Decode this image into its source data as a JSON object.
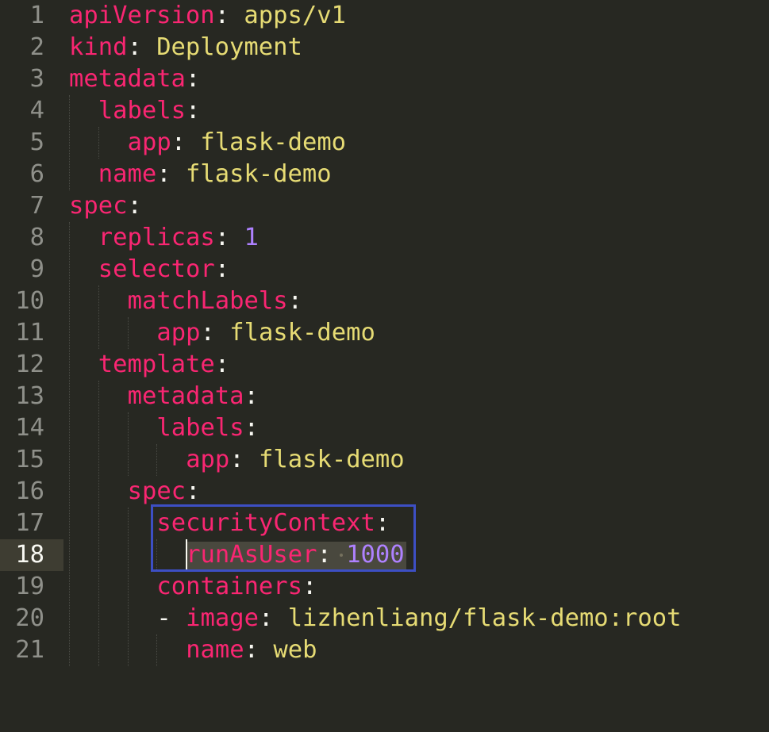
{
  "editor": {
    "language": "yaml",
    "theme_colors": {
      "background": "#272822",
      "key": "#f92672",
      "string": "#e6db74",
      "number": "#ae81ff",
      "punctuation": "#f8f8f2",
      "line_number": "#8f908a",
      "highlight_box": "#3d4fc4"
    },
    "current_line": 18,
    "highlighted_lines": [
      17,
      18
    ],
    "lines": [
      {
        "n": "1",
        "key": "apiVersion",
        "sep": ": ",
        "value": "apps/v1",
        "vtype": "s"
      },
      {
        "n": "2",
        "key": "kind",
        "sep": ": ",
        "value": "Deployment",
        "vtype": "s"
      },
      {
        "n": "3",
        "key": "metadata",
        "sep": ":",
        "value": "",
        "vtype": "s"
      },
      {
        "n": "4",
        "key": "labels",
        "sep": ":",
        "value": "",
        "vtype": "s"
      },
      {
        "n": "5",
        "key": "app",
        "sep": ": ",
        "value": "flask-demo",
        "vtype": "s"
      },
      {
        "n": "6",
        "key": "name",
        "sep": ": ",
        "value": "flask-demo",
        "vtype": "s"
      },
      {
        "n": "7",
        "key": "spec",
        "sep": ":",
        "value": "",
        "vtype": "s"
      },
      {
        "n": "8",
        "key": "replicas",
        "sep": ": ",
        "value": "1",
        "vtype": "n"
      },
      {
        "n": "9",
        "key": "selector",
        "sep": ":",
        "value": "",
        "vtype": "s"
      },
      {
        "n": "10",
        "key": "matchLabels",
        "sep": ":",
        "value": "",
        "vtype": "s"
      },
      {
        "n": "11",
        "key": "app",
        "sep": ": ",
        "value": "flask-demo",
        "vtype": "s"
      },
      {
        "n": "12",
        "key": "template",
        "sep": ":",
        "value": "",
        "vtype": "s"
      },
      {
        "n": "13",
        "key": "metadata",
        "sep": ":",
        "value": "",
        "vtype": "s"
      },
      {
        "n": "14",
        "key": "labels",
        "sep": ":",
        "value": "",
        "vtype": "s"
      },
      {
        "n": "15",
        "key": "app",
        "sep": ": ",
        "value": "flask-demo",
        "vtype": "s"
      },
      {
        "n": "16",
        "key": "spec",
        "sep": ":",
        "value": "",
        "vtype": "s"
      },
      {
        "n": "17",
        "key": "securityContext",
        "sep": ":",
        "value": "",
        "vtype": "s"
      },
      {
        "n": "18",
        "key": "runAsUser",
        "sep": ": ",
        "value": "1000",
        "vtype": "n"
      },
      {
        "n": "19",
        "key": "containers",
        "sep": ":",
        "value": "",
        "vtype": "s"
      },
      {
        "n": "20",
        "dash": "- ",
        "key": "image",
        "sep": ": ",
        "value": "lizhenliang/flask-demo:root",
        "vtype": "s"
      },
      {
        "n": "21",
        "key": "name",
        "sep": ": ",
        "value": "web",
        "vtype": "s"
      }
    ]
  }
}
